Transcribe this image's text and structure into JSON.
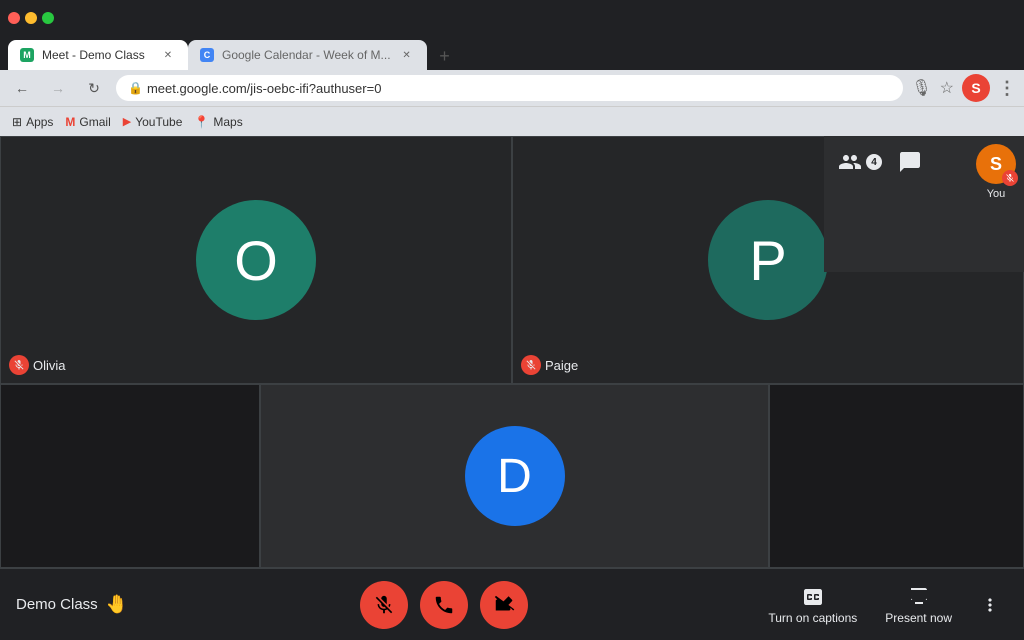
{
  "browser": {
    "tabs": [
      {
        "id": "tab-meet",
        "title": "Meet - Demo Class",
        "favicon": "M",
        "favicon_color": "#1da462",
        "active": true
      },
      {
        "id": "tab-calendar",
        "title": "Google Calendar - Week of M...",
        "favicon": "C",
        "favicon_color": "#4285f4",
        "active": false
      }
    ],
    "address": "meet.google.com/jis-oebc-ifi?authuser=0",
    "bookmarks": [
      {
        "id": "apps",
        "label": "Apps",
        "icon": "grid"
      },
      {
        "id": "gmail",
        "label": "Gmail",
        "icon": "M"
      },
      {
        "id": "youtube",
        "label": "YouTube",
        "icon": "YT"
      },
      {
        "id": "maps",
        "label": "Maps",
        "icon": "pin"
      }
    ]
  },
  "meet": {
    "participants": [
      {
        "id": "olivia",
        "initial": "O",
        "name": "Olivia",
        "muted": true,
        "color": "#1e7e6a",
        "position": "top-left"
      },
      {
        "id": "paige",
        "initial": "P",
        "name": "Paige",
        "muted": true,
        "color": "#1e6a5e",
        "position": "top-right"
      },
      {
        "id": "d",
        "initial": "D",
        "name": "",
        "muted": false,
        "color": "#1a73e8",
        "position": "bottom-center"
      }
    ],
    "self": {
      "initial": "S",
      "label": "You",
      "color": "#e8710a",
      "muted": true
    },
    "people_count": 4,
    "meeting_title": "Demo Class",
    "controls": {
      "mute_label": "Mute",
      "end_label": "Leave call",
      "camera_label": "Turn off camera"
    },
    "bottom_actions": [
      {
        "id": "captions",
        "label": "Turn on captions",
        "icon": "cc"
      },
      {
        "id": "present",
        "label": "Present now",
        "icon": "present"
      }
    ],
    "more_options_label": "More options"
  },
  "icons": {
    "people": "👥",
    "chat": "💬",
    "mic_off": "🎤",
    "camera_off": "📷",
    "phone": "📞",
    "captions": "CC",
    "present": "⬛",
    "dots": "⋮",
    "back": "←",
    "forward": "→",
    "reload": "↻",
    "star": "☆",
    "mic_browser": "🎙",
    "shield": "🔒"
  }
}
